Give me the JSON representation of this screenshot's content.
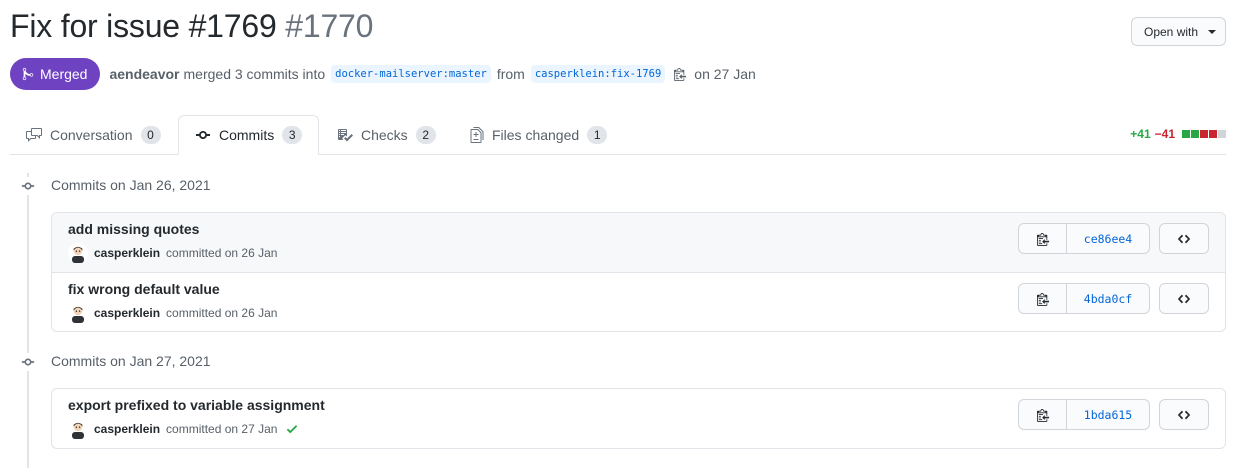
{
  "pr": {
    "title": "Fix for issue #1769",
    "number": "#1770",
    "state": "Merged",
    "author": "aendeavor",
    "merge_text": "merged 3 commits into",
    "base_branch": "docker-mailserver:master",
    "from_text": "from",
    "head_branch": "casperklein:fix-1769",
    "date_text": "on 27 Jan"
  },
  "open_with": {
    "label": "Open with"
  },
  "tabs": [
    {
      "label": "Conversation",
      "count": "0",
      "icon": "comment-discussion-icon"
    },
    {
      "label": "Commits",
      "count": "3",
      "icon": "git-commit-icon"
    },
    {
      "label": "Checks",
      "count": "2",
      "icon": "checklist-icon"
    },
    {
      "label": "Files changed",
      "count": "1",
      "icon": "file-diff-icon"
    }
  ],
  "diffstat": {
    "additions": "+41",
    "deletions": "−41",
    "blocks": [
      "add",
      "add",
      "del",
      "del",
      "neutral"
    ],
    "colors": {
      "add": "#28a745",
      "del": "#cb2431",
      "neutral": "#d1d5da"
    }
  },
  "groups": [
    {
      "heading": "Commits on Jan 26, 2021",
      "commits": [
        {
          "message": "add missing quotes",
          "author": "casperklein",
          "committed": "committed on 26 Jan",
          "sha": "ce86ee4",
          "checked": false
        },
        {
          "message": "fix wrong default value",
          "author": "casperklein",
          "committed": "committed on 26 Jan",
          "sha": "4bda0cf",
          "checked": false
        }
      ]
    },
    {
      "heading": "Commits on Jan 27, 2021",
      "commits": [
        {
          "message": "export prefixed to variable assignment",
          "author": "casperklein",
          "committed": "committed on 27 Jan",
          "sha": "1bda615",
          "checked": true
        }
      ]
    }
  ],
  "colors": {
    "merged": "#6f42c1",
    "link": "#0366d6",
    "success": "#28a745"
  }
}
